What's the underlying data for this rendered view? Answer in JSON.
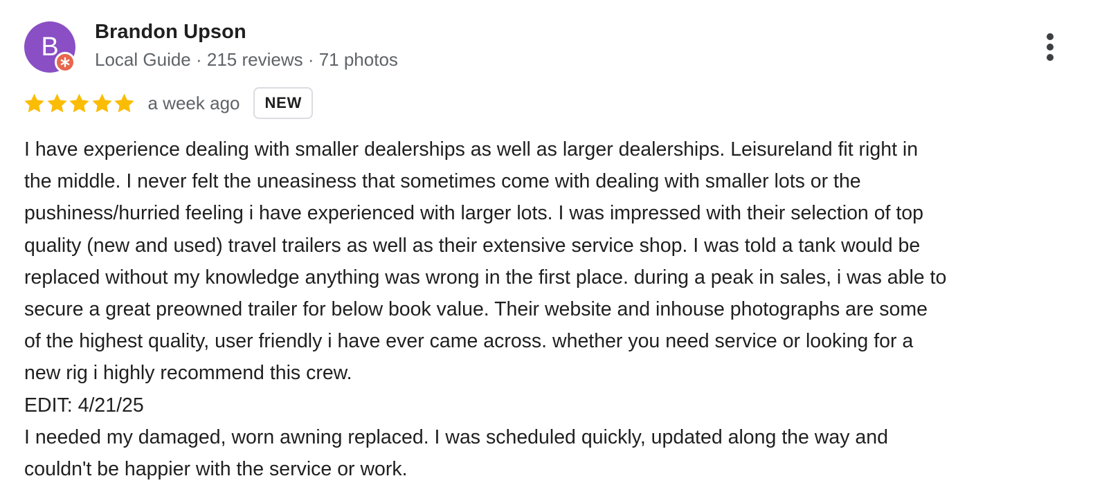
{
  "reviewer": {
    "avatar_initial": "B",
    "avatar_color": "#8a4fc4",
    "badge_icon": "local-guide-star-icon",
    "badge_color": "#e8674d",
    "name": "Brandon Upson",
    "meta": "Local Guide · 215 reviews · 71 photos"
  },
  "rating": {
    "stars": 5,
    "max": 5,
    "star_color": "#fbbc04"
  },
  "date": "a week ago",
  "badge_label": "NEW",
  "menu_icon": "more-vertical-icon",
  "review_lines": [
    "I have experience dealing with smaller dealerships as well as larger dealerships. Leisureland fit right in",
    "the middle. I never felt the uneasiness that sometimes come with dealing with smaller lots or the",
    "pushiness/hurried feeling i have experienced with larger lots. I was impressed with their selection of top",
    "quality (new and used) travel trailers as well as their extensive service shop. I was told a tank would be",
    "replaced without my knowledge anything was wrong in the first place. during a peak in sales, i was able to",
    "secure a great preowned trailer for below book value. Their website and inhouse photographs are some",
    "of the highest quality, user friendly i have ever came across. whether you need service or looking for a",
    "new rig i highly recommend this crew.",
    "EDIT: 4/21/25",
    "I needed my damaged, worn awning replaced. I was scheduled quickly, updated along the way and",
    "couldn't be happier with the service or work."
  ]
}
